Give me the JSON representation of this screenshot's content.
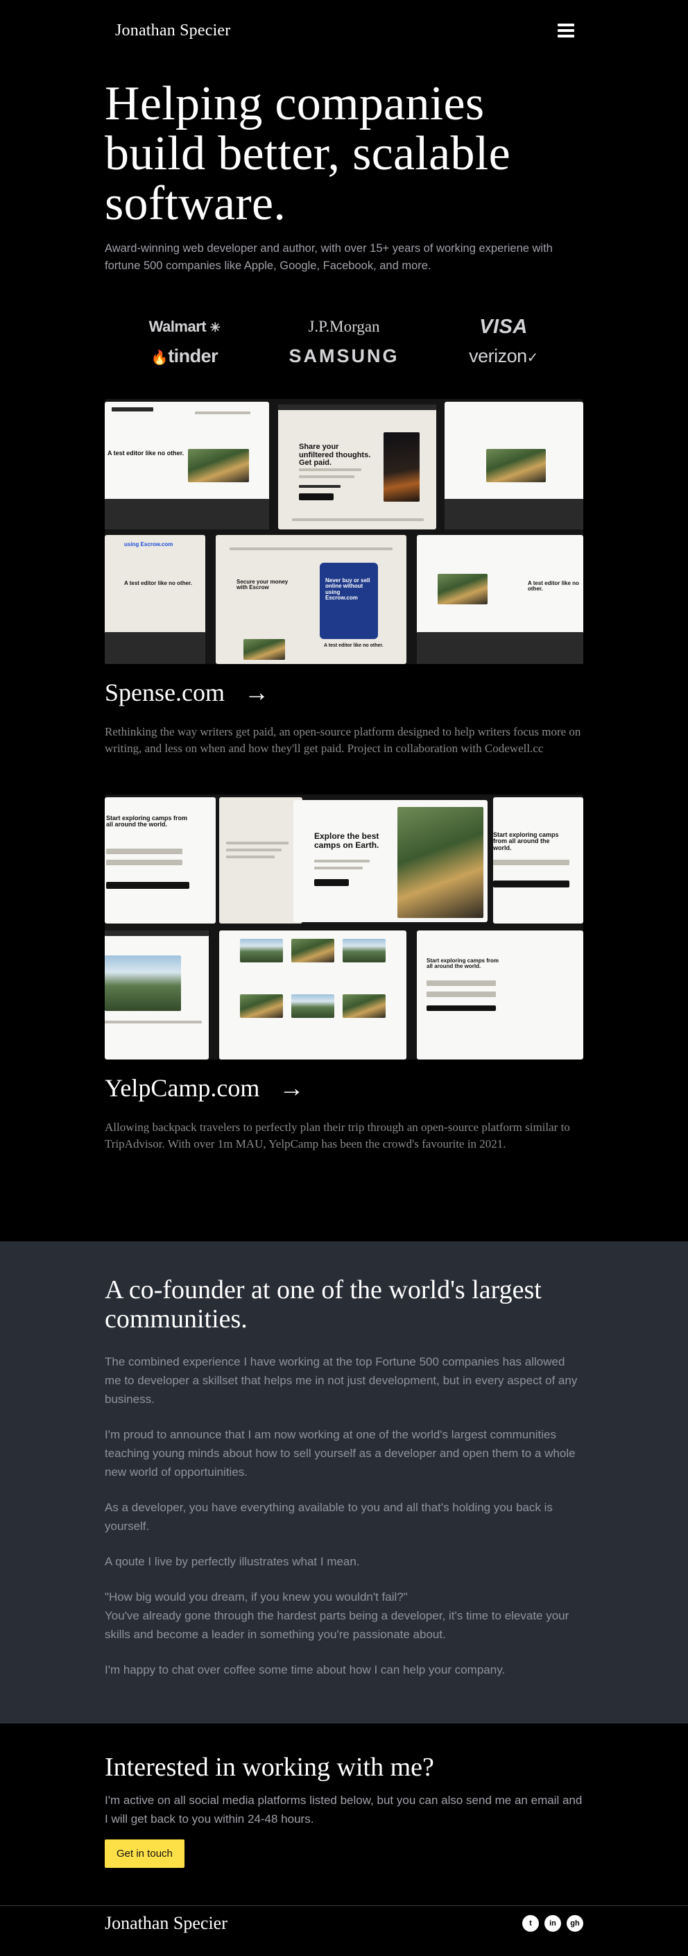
{
  "header": {
    "brand": "Jonathan Specier",
    "menu_icon": "hamburger-menu-icon"
  },
  "hero": {
    "title": "Helping companies build better, scalable software.",
    "subtitle": "Award-winning web developer and author, with over 15+ years of working experiene with fortune 500 companies like Apple, Google, Facebook, and more."
  },
  "logos": [
    {
      "name": "Walmart",
      "text": "Walmart",
      "mark": "✳"
    },
    {
      "name": "J.P.Morgan",
      "text": "J.P.Morgan"
    },
    {
      "name": "VISA",
      "text": "VISA"
    },
    {
      "name": "tinder",
      "text": "tinder",
      "mark": "🔥"
    },
    {
      "name": "SAMSUNG",
      "text": "SAMSUNG"
    },
    {
      "name": "verizon",
      "text": "verizon",
      "mark": "✓"
    }
  ],
  "projects": [
    {
      "title": "Spense.com",
      "arrow": "→",
      "description": "Rethinking the way writers get paid, an open-source platform designed to help writers focus more on writing, and less on when and how they'll get paid. Project in collaboration with Codewell.cc",
      "shot_texts": {
        "headline": "Share your unfiltered thoughts. Get paid.",
        "secondary": "Secure your money with Escrow",
        "phone_text": "Never buy or sell online without using Escrow.com",
        "side": "A test editor like no other.",
        "escrow": "using Escrow.com"
      }
    },
    {
      "title": "YelpCamp.com",
      "arrow": "→",
      "description": "Allowing backpack travelers to perfectly plan their trip through an open-source platform similar to TripAdvisor. With over 1m MAU, YelpCamp has been the crowd's favourite in 2021.",
      "shot_texts": {
        "headline": "Explore the best camps on Earth.",
        "signup": "Start exploring camps from all around the world."
      }
    }
  ],
  "community": {
    "title": "A co-founder at one of the world's largest communities.",
    "paragraphs": [
      "The combined experience I have working at the top Fortune 500 companies has allowed me to developer a skillset that helps me in not just development, but in every aspect of any business.",
      "I'm proud to announce that I am now working at one of the world's largest communities teaching young minds about how to sell yourself as a developer and open them to a whole new world of opportuinities.",
      "As a developer, you have everything available to you and all that's holding you back is yourself.",
      "A qoute I live by perfectly illustrates what I mean.",
      "\"How big would you dream, if you knew you wouldn't fail?\"",
      "You've already gone through the hardest parts being a developer, it's time to elevate your skills and become a leader in something you're passionate about.",
      "I'm happy to chat over coffee some time about how I can help your company."
    ]
  },
  "contact": {
    "title": "Interested in working with me?",
    "text": "I'm active on all social media platforms listed below, but you can also send me an email and I will get back to you within 24-48 hours.",
    "button": "Get in touch"
  },
  "footer": {
    "brand": "Jonathan Specier",
    "socials": [
      {
        "icon": "twitter-icon",
        "glyph": "t"
      },
      {
        "icon": "linkedin-icon",
        "glyph": "in"
      },
      {
        "icon": "github-icon",
        "glyph": "gh"
      }
    ]
  },
  "colors": {
    "background": "#000000",
    "community_bg": "#292d36",
    "accent_yellow": "#fde047",
    "muted_text": "#a1a1aa"
  }
}
